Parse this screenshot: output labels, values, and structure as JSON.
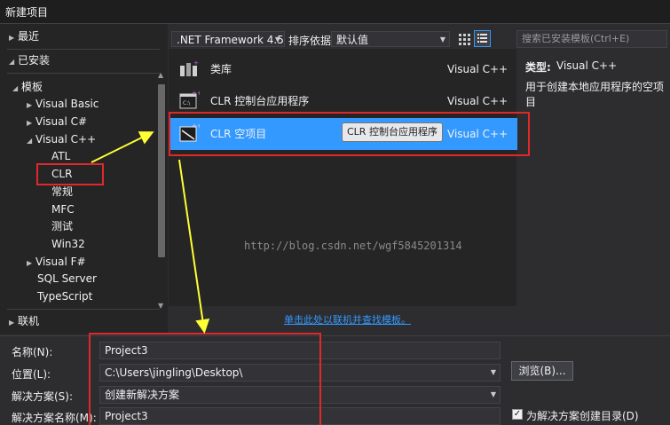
{
  "window": {
    "title": "新建项目"
  },
  "tree": {
    "recent": "最近",
    "installed": "已安装",
    "templates": "模板",
    "visual_basic": "Visual Basic",
    "visual_csharp": "Visual C#",
    "visual_cpp": "Visual C++",
    "atl": "ATL",
    "clr": "CLR",
    "general": "常规",
    "mfc": "MFC",
    "test": "测试",
    "win32": "Win32",
    "visual_fsharp": "Visual F#",
    "sql_server": "SQL Server",
    "typescript": "TypeScript",
    "online": "联机"
  },
  "toolbar": {
    "framework": ".NET Framework 4.5",
    "sort_label": "排序依据:",
    "sort_value": "默认值"
  },
  "templates": [
    {
      "name": "类库",
      "lang": "Visual C++"
    },
    {
      "name": "CLR 控制台应用程序",
      "lang": "Visual C++"
    },
    {
      "name": "CLR 空项目",
      "lang": "Visual C++"
    }
  ],
  "tooltip": "CLR 控制台应用程序",
  "search": {
    "placeholder": "搜索已安装模板(Ctrl+E)"
  },
  "details": {
    "type_label": "类型:",
    "type_value": "Visual C++",
    "description": "用于创建本地应用程序的空项目"
  },
  "watermark": "http://blog.csdn.net/wgf5845201314",
  "online_link": "单击此处以联机并查找模板。",
  "form": {
    "name_label": "名称(N):",
    "name_value": "Project3",
    "location_label": "位置(L):",
    "location_value": "C:\\Users\\jingling\\Desktop\\",
    "solution_label": "解决方案(S):",
    "solution_value": "创建新解决方案",
    "solution_name_label": "解决方案名称(M):",
    "solution_name_value": "Project3",
    "browse_label": "浏览(B)...",
    "create_dir_label": "为解决方案创建目录(D)",
    "create_dir_checked": true
  },
  "colors": {
    "background": "#2d2d30",
    "selection": "#3399ff",
    "annotation_red": "#e0282a",
    "annotation_yellow": "#ffff33"
  }
}
